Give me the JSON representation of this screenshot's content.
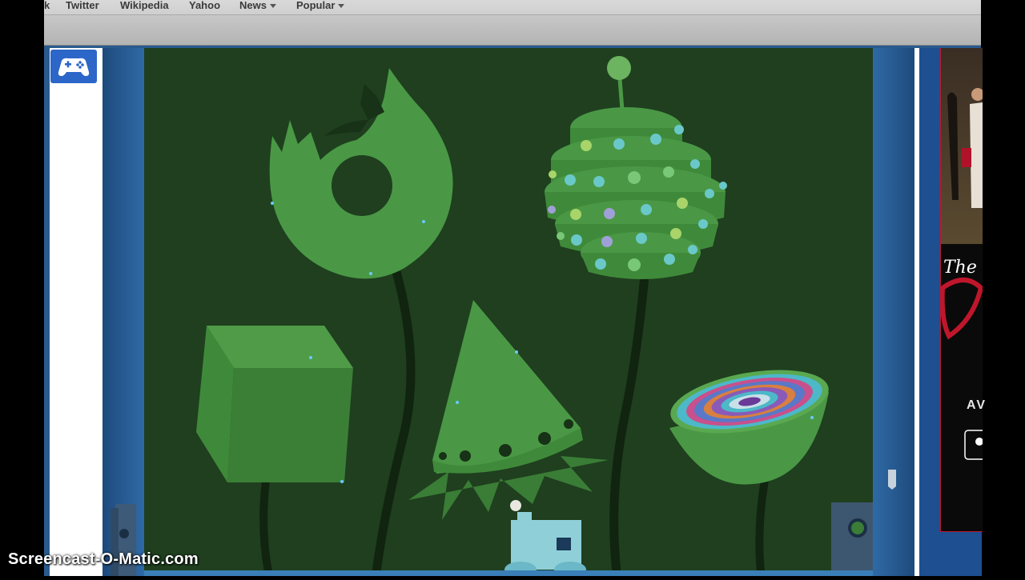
{
  "bookmarks": {
    "partial": "k",
    "items": [
      {
        "label": "Twitter"
      },
      {
        "label": "Wikipedia"
      },
      {
        "label": "Yahoo"
      },
      {
        "label": "News"
      },
      {
        "label": "Popular"
      }
    ]
  },
  "sidebar": {
    "game_icon": "gamepad-icon"
  },
  "ad": {
    "script_text": "The",
    "bottom_text": "AV"
  },
  "watermark": "Screencast-O-Matic.com",
  "colors": {
    "game_bg": "#1f3f1f",
    "shape_green": "#4e9a47",
    "stem": "#122612",
    "page_blue": "#2a5a8e",
    "robot": "#8fd0d8"
  }
}
